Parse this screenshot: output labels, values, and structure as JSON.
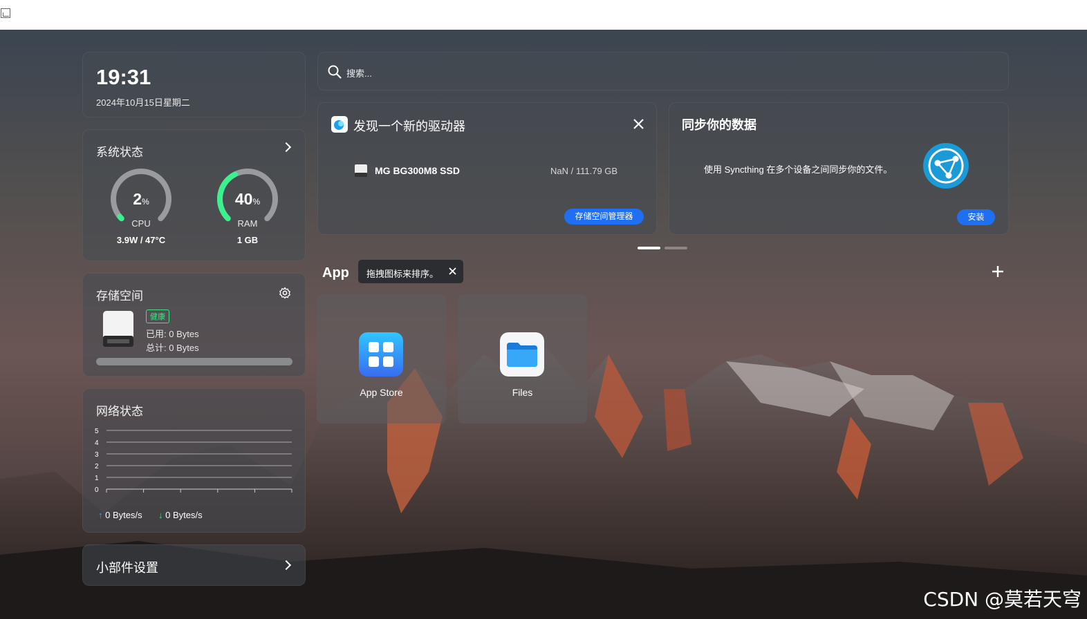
{
  "clock": {
    "time": "19:31",
    "date": "2024年10月15日星期二"
  },
  "system_status": {
    "title": "系统状态",
    "cpu": {
      "percent": 2,
      "value": "2",
      "unit": "%",
      "label": "CPU",
      "detail": "3.9W / 47°C"
    },
    "ram": {
      "percent": 40,
      "value": "40",
      "unit": "%",
      "label": "RAM",
      "detail": "1 GB"
    }
  },
  "storage": {
    "title": "存储空间",
    "badge": "健康",
    "used": "已用: 0 Bytes",
    "total": "总计: 0 Bytes",
    "usage_fraction": 0
  },
  "network": {
    "title": "网络状态",
    "y_ticks": [
      "5",
      "4",
      "3",
      "2",
      "1",
      "0"
    ],
    "upload": "0 Bytes/s",
    "download": "0 Bytes/s"
  },
  "widget_settings": {
    "label": "小部件设置"
  },
  "search": {
    "placeholder": "搜索..."
  },
  "new_drive": {
    "title": "发现一个新的驱动器",
    "drive_name": "MG BG300M8 SSD",
    "drive_size": "NaN / 111.79 GB",
    "button": "存储空间管理器"
  },
  "sync": {
    "title": "同步你的数据",
    "description": "使用 Syncthing 在多个设备之间同步你的文件。",
    "button": "安装"
  },
  "carousel": {
    "active_index": 0,
    "count": 2
  },
  "apps": {
    "heading": "App",
    "tooltip": "拖拽图标来排序。",
    "items": [
      {
        "label": "App Store",
        "icon": "app-store-icon"
      },
      {
        "label": "Files",
        "icon": "folder-icon"
      }
    ]
  },
  "watermark": "CSDN @莫若天穹",
  "colors": {
    "accent": "#1f6ff2",
    "gauge_green": "#3cf08f",
    "healthy": "#3ce58a"
  }
}
